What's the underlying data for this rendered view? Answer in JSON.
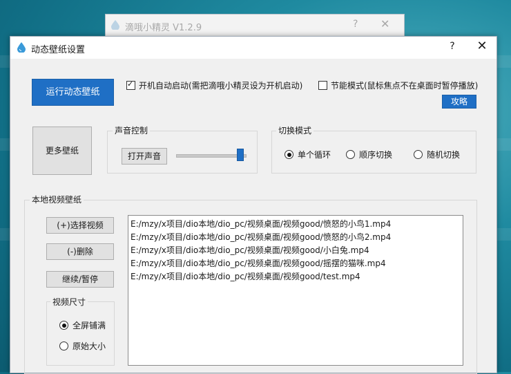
{
  "background_window": {
    "title": "滴哦小精灵 V1.2.9",
    "help": "?",
    "close": "✕"
  },
  "window": {
    "title": "动态壁纸设置",
    "help": "?",
    "close": "✕"
  },
  "toolbar": {
    "run_button": "运行动态壁纸",
    "autostart_label": "开机自动启动(需把滴哦小精灵设为开机启动)",
    "autostart_checked": true,
    "powersave_label": "节能模式(鼠标焦点不在桌面时暂停播放)",
    "powersave_checked": false,
    "guide_button": "攻略"
  },
  "more_button": "更多壁纸",
  "sound": {
    "group_label": "声音控制",
    "toggle_button": "打开声音",
    "volume": 0.95
  },
  "switch_mode": {
    "group_label": "切换模式",
    "options": [
      "单个循环",
      "顺序切换",
      "随机切换"
    ],
    "selected": "单个循环"
  },
  "local": {
    "group_label": "本地视频壁纸",
    "select_button": "(+)选择视频",
    "delete_button": "(-)删除",
    "pause_button": "继续/暂停",
    "size": {
      "group_label": "视频尺寸",
      "options": [
        "全屏铺满",
        "原始大小"
      ],
      "selected": "全屏铺满"
    },
    "files": [
      "E:/mzy/x项目/dio本地/dio_pc/视频桌面/视频good/愤怒的小鸟1.mp4",
      "E:/mzy/x项目/dio本地/dio_pc/视频桌面/视频good/愤怒的小鸟2.mp4",
      "E:/mzy/x项目/dio本地/dio_pc/视频桌面/视频good/小白兔.mp4",
      "E:/mzy/x项目/dio本地/dio_pc/视频桌面/视频good/摇摆的猫咪.mp4",
      "E:/mzy/x项目/dio本地/dio_pc/视频桌面/视频good/test.mp4"
    ]
  },
  "colors": {
    "accent": "#1f6fc5",
    "window_bg": "#f0f0f0",
    "desktop": "#1f8aa0"
  }
}
